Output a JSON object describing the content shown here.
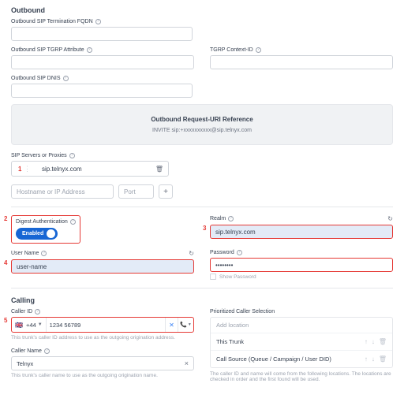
{
  "outbound": {
    "title": "Outbound",
    "fqdn_label": "Outbound SIP Termination FQDN",
    "tgrp_label": "Outbound SIP TGRP Attribute",
    "tgrp_context_label": "TGRP Context-ID",
    "dnis_label": "Outbound SIP DNIS",
    "ref_title": "Outbound Request-URI Reference",
    "ref_body": "INVITE sip:+xxxxxxxxxx@sip.telnyx.com",
    "sip_label": "SIP Servers or Proxies",
    "sip_value": "sip.telnyx.com",
    "host_placeholder": "Hostname or IP Address",
    "port_placeholder": "Port"
  },
  "marks": {
    "m1": "1",
    "m2": "2",
    "m3": "3",
    "m4": "4",
    "m5": "5"
  },
  "auth": {
    "digest_label": "Digest Authentication",
    "enabled_label": "Enabled",
    "realm_label": "Realm",
    "realm_value": "sip.telnyx.com",
    "user_label": "User Name",
    "user_value": "user-name",
    "password_label": "Password",
    "password_value": "••••••••",
    "show_pw": "Show Password"
  },
  "calling": {
    "title": "Calling",
    "caller_id_label": "Caller ID",
    "flag": "🇬🇧",
    "cc": "+44",
    "number": "1234 56789",
    "caller_id_help": "This trunk's caller ID address to use as the outgoing origination address.",
    "caller_name_label": "Caller Name",
    "caller_name_value": "Telnyx",
    "caller_name_help": "This trunk's caller name to use as the outgoing origination name.",
    "prioritized_label": "Prioritized Caller Selection",
    "add_location": "Add location",
    "item1": "This Trunk",
    "item2": "Call Source (Queue / Campaign / User DID)",
    "footer": "The caller ID and name will come from the following locations. The locations are checked in order and the first found will be used."
  }
}
